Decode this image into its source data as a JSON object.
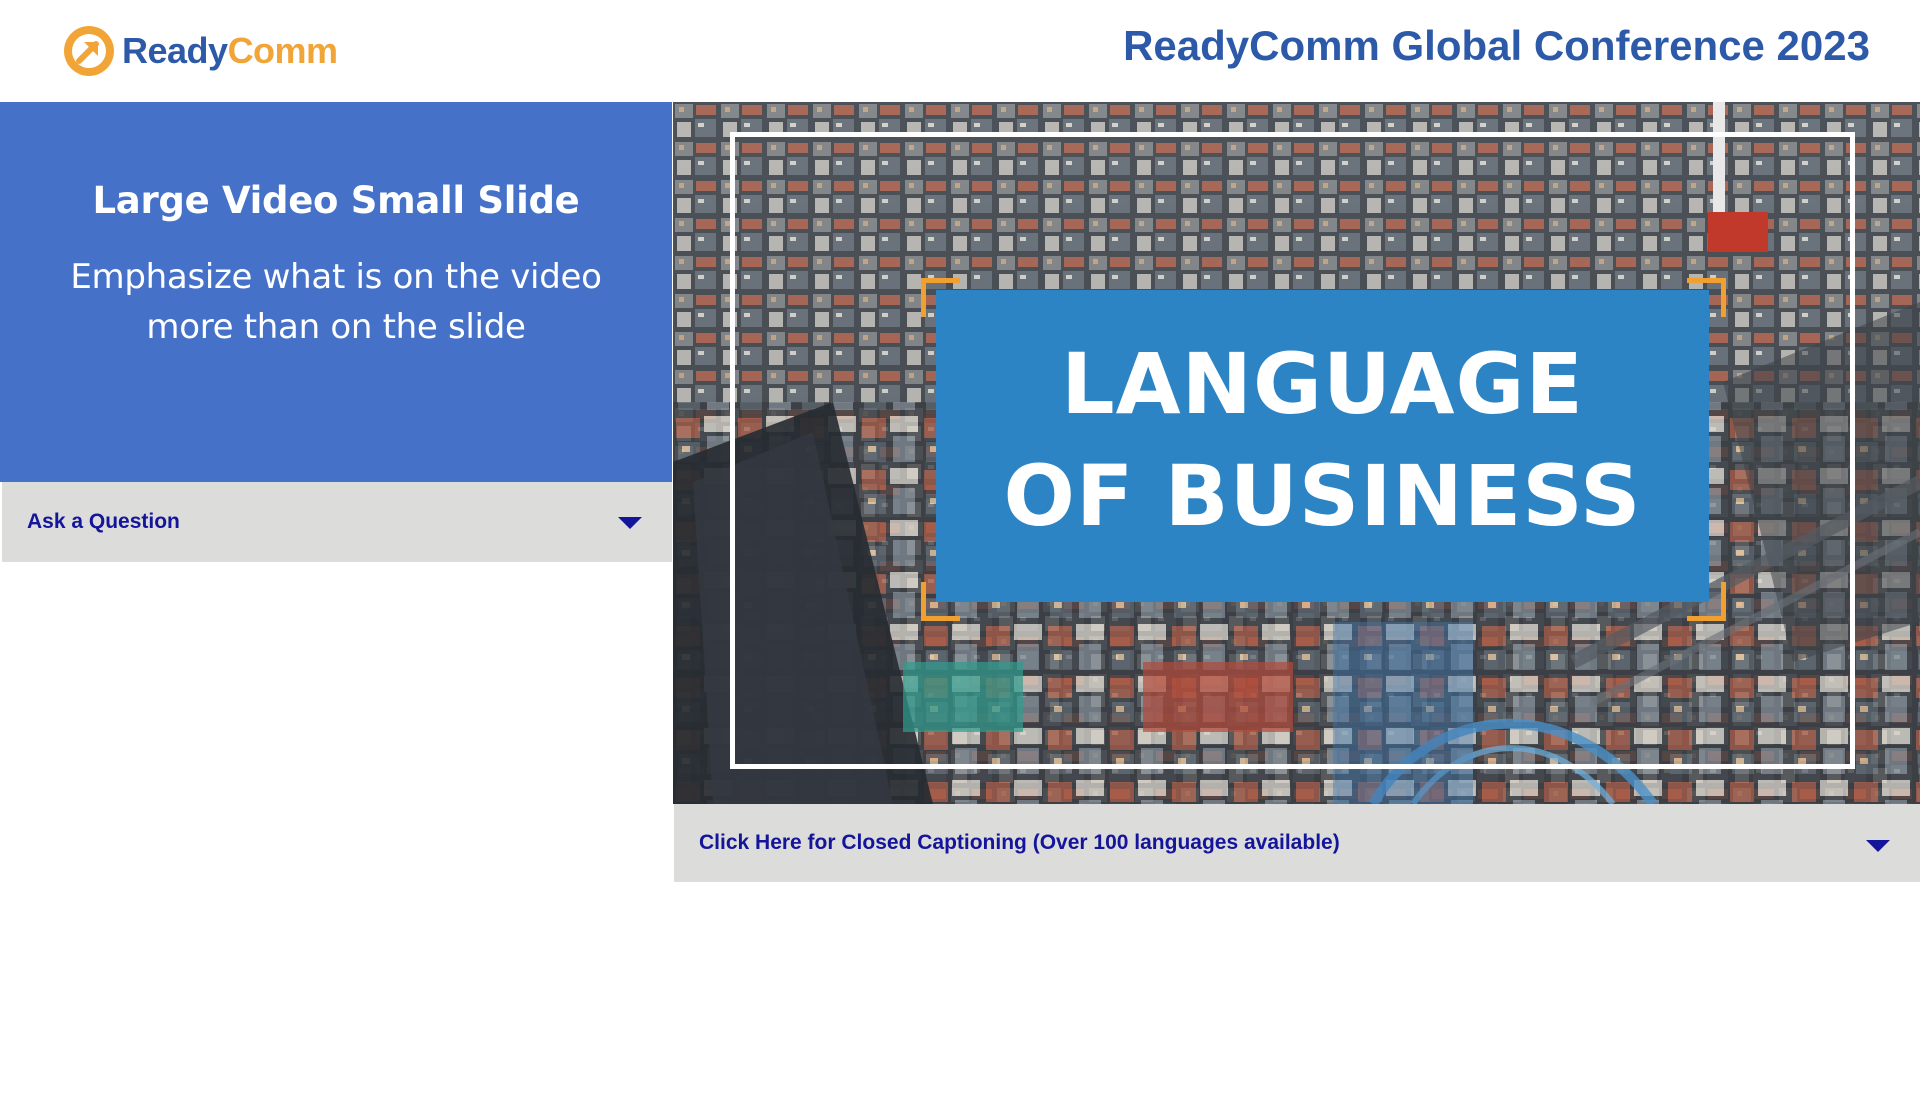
{
  "header": {
    "logo": {
      "text_part1": "Ready",
      "text_part2": "Comm",
      "icon": "arrow-circle-icon",
      "colors": {
        "blue": "#2d5aa8",
        "orange": "#f2a537"
      }
    },
    "conference_title": "ReadyComm Global Conference 2023"
  },
  "slide": {
    "title": "Large Video Small Slide",
    "subtitle": "Emphasize what is on the video more than on the slide",
    "background_color": "#4571c9"
  },
  "ask_question": {
    "label": "Ask a Question",
    "icon": "caret-down-icon"
  },
  "video": {
    "overlay_title_line1": "LANGUAGE",
    "overlay_title_line2": "OF BUSINESS",
    "title_box_color": "#2c84c4",
    "bracket_color": "#f0a030"
  },
  "closed_captioning": {
    "label": "Click Here for Closed Captioning (Over 100 languages available)",
    "icon": "caret-down-icon"
  },
  "colors": {
    "accordion_bg": "#dcdcda",
    "accordion_text": "#14159a"
  }
}
